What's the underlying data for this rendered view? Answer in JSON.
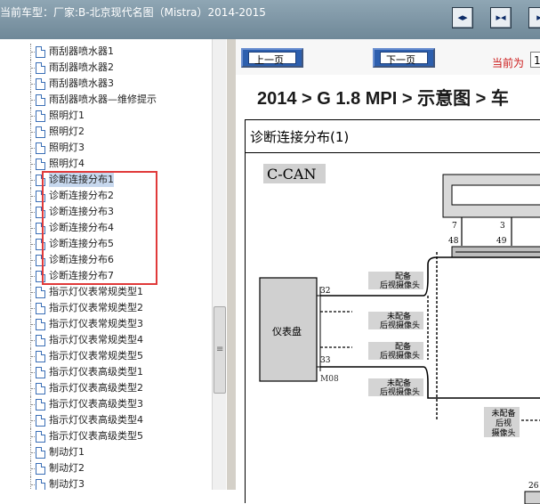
{
  "window": {
    "title": "当前车型：厂家:B-北京现代名图（Mistra）2014-2015",
    "toolbar_buttons": [
      "collapse-left-icon",
      "split-view-icon",
      "collapse-right-icon"
    ]
  },
  "tree": {
    "items": [
      {
        "label": "雨刮器喷水器1"
      },
      {
        "label": "雨刮器喷水器2"
      },
      {
        "label": "雨刮器喷水器3"
      },
      {
        "label": "雨刮器喷水器—维修提示"
      },
      {
        "label": "照明灯1"
      },
      {
        "label": "照明灯2"
      },
      {
        "label": "照明灯3"
      },
      {
        "label": "照明灯4"
      },
      {
        "label": "诊断连接分布1"
      },
      {
        "label": "诊断连接分布2"
      },
      {
        "label": "诊断连接分布3"
      },
      {
        "label": "诊断连接分布4"
      },
      {
        "label": "诊断连接分布5"
      },
      {
        "label": "诊断连接分布6"
      },
      {
        "label": "诊断连接分布7"
      },
      {
        "label": "指示灯仪表常规类型1"
      },
      {
        "label": "指示灯仪表常规类型2"
      },
      {
        "label": "指示灯仪表常规类型3"
      },
      {
        "label": "指示灯仪表常规类型4"
      },
      {
        "label": "指示灯仪表常规类型5"
      },
      {
        "label": "指示灯仪表高级类型1"
      },
      {
        "label": "指示灯仪表高级类型2"
      },
      {
        "label": "指示灯仪表高级类型3"
      },
      {
        "label": "指示灯仪表高级类型4"
      },
      {
        "label": "指示灯仪表高级类型5"
      },
      {
        "label": "制动灯1"
      },
      {
        "label": "制动灯2"
      },
      {
        "label": "制动灯3"
      }
    ],
    "selected_index": 8,
    "highlight_color": "#e03a3a"
  },
  "nav": {
    "prev_label": "上一页",
    "next_label": "下一页",
    "current_label": "当前为",
    "current_page": "1"
  },
  "document": {
    "title": "2014 > G 1.8 MPI > 示意图 > 车",
    "section_title": "诊断连接分布(1)"
  },
  "diagram": {
    "bus_label": "C-CAN",
    "module_label": "仪表盘",
    "pins": [
      "7",
      "3",
      "48",
      "49",
      "32",
      "33",
      "26"
    ],
    "connector_label": "M08",
    "camera_boxes": [
      {
        "line1": "配备",
        "line2": "后视摄像头"
      },
      {
        "line1": "未配备",
        "line2": "后视摄像头"
      },
      {
        "line1": "配备",
        "line2": "后视摄像头"
      },
      {
        "line1": "未配备",
        "line2": "后视摄像头"
      }
    ],
    "right_note": {
      "line1": "未配备",
      "line2": "后视",
      "line3": "摄像头"
    }
  }
}
